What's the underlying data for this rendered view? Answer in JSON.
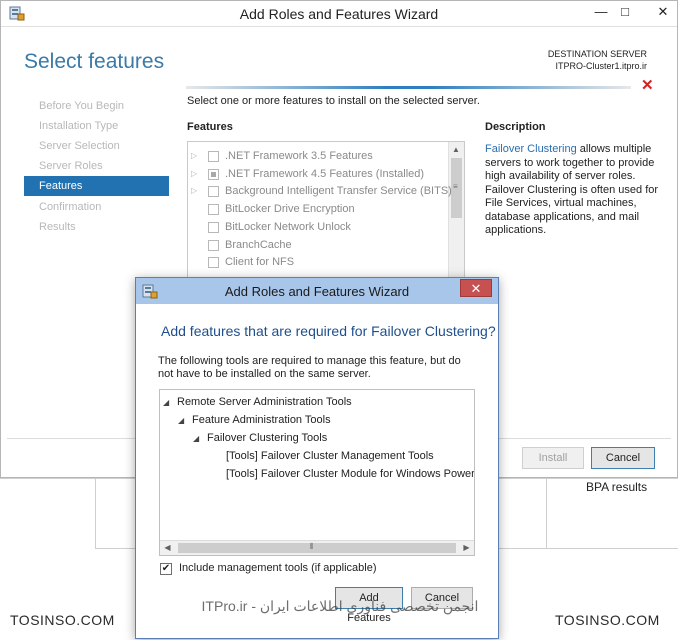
{
  "main_window": {
    "title": "Add Roles and Features Wizard",
    "controls": {
      "minimize": "—",
      "maximize": "□",
      "close": "✕"
    },
    "page_title": "Select features",
    "destination_label": "DESTINATION SERVER",
    "destination_server": "ITPRO-Cluster1.itpro.ir",
    "nav": [
      {
        "label": "Before You Begin",
        "active": false
      },
      {
        "label": "Installation Type",
        "active": false
      },
      {
        "label": "Server Selection",
        "active": false
      },
      {
        "label": "Server Roles",
        "active": false
      },
      {
        "label": "Features",
        "active": true
      },
      {
        "label": "Confirmation",
        "active": false
      },
      {
        "label": "Results",
        "active": false
      }
    ],
    "instruction": "Select one or more features to install on the selected server.",
    "features_heading": "Features",
    "features": [
      {
        "label": ".NET Framework 3.5 Features",
        "expandable": true,
        "state": "unchecked"
      },
      {
        "label": ".NET Framework 4.5 Features (Installed)",
        "expandable": true,
        "state": "partial"
      },
      {
        "label": "Background Intelligent Transfer Service (BITS)",
        "expandable": true,
        "state": "unchecked"
      },
      {
        "label": "BitLocker Drive Encryption",
        "expandable": false,
        "state": "unchecked"
      },
      {
        "label": "BitLocker Network Unlock",
        "expandable": false,
        "state": "unchecked"
      },
      {
        "label": "BranchCache",
        "expandable": false,
        "state": "unchecked"
      },
      {
        "label": "Client for NFS",
        "expandable": false,
        "state": "unchecked"
      }
    ],
    "description_heading": "Description",
    "description_link": "Failover Clustering",
    "description_lines": [
      " allows multiple",
      "servers to work together to provide",
      "high availability of server roles.",
      "Failover Clustering is often used for",
      "File Services, virtual machines,",
      "database applications, and mail",
      "applications."
    ],
    "install_label": "Install",
    "cancel_label": "Cancel"
  },
  "background_page": {
    "bpa_results": "BPA results"
  },
  "dialog": {
    "title": "Add Roles and Features Wizard",
    "close": "✕",
    "heading": "Add features that are required for Failover Clustering?",
    "body": "The following tools are required to manage this feature, but do not have to be installed on the same server.",
    "tree": [
      {
        "label": "Remote Server Administration Tools",
        "level": 0,
        "expander": "◢"
      },
      {
        "label": "Feature Administration Tools",
        "level": 1,
        "expander": "◢"
      },
      {
        "label": "Failover Clustering Tools",
        "level": 2,
        "expander": "◢"
      },
      {
        "label": "[Tools] Failover Cluster Management Tools",
        "level": 3,
        "expander": ""
      },
      {
        "label": "[Tools] Failover Cluster Module for Windows PowerShe",
        "level": 3,
        "expander": ""
      }
    ],
    "scroll_left": "◀",
    "scroll_right": "▶",
    "include_label": "Include management tools (if applicable)",
    "include_checked": true,
    "checkmark": "✔",
    "add_features_label": "Add Features",
    "cancel_label": "Cancel"
  },
  "watermark": {
    "left": "TOSINSO.COM",
    "center": "انجمن تخصصی فناوری اطلاعات ایران - ITPro.ir",
    "right": "TOSINSO.COM"
  }
}
